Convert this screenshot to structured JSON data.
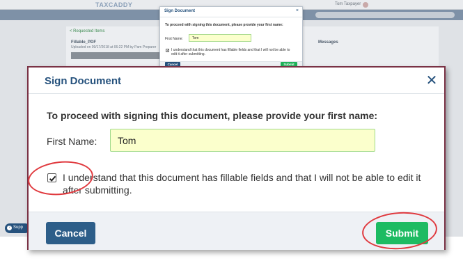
{
  "background": {
    "logo": "TAXCADDY",
    "user_name": "Tom Taxpayer",
    "back_link": "< Requested Items",
    "file_name": "Fillable_PDF",
    "uploaded_text": "Uploaded on 09/17/2018 at 06:22 PM by Pam Preparer",
    "messages_header": "Messages",
    "support_label": "Supp"
  },
  "mini_dialog": {
    "title": "Sign Document",
    "close_glyph": "×",
    "prompt": "To proceed with signing this document, please provide your first name:",
    "first_name_label": "First Name:",
    "first_name_value": "Tom",
    "checkbox_text": "I understand that this document has fillable fields and that I will not be able to edit it after submitting.",
    "cancel_label": "Cancel",
    "submit_label": "Submit"
  },
  "dialog": {
    "title": "Sign Document",
    "close_glyph": "✕",
    "prompt": "To proceed with signing this document, please provide your first name:",
    "first_name_label": "First Name:",
    "first_name_value": "Tom",
    "checkbox_checked": true,
    "checkbox_text": "I understand that this document has fillable fields and that I will not be able to edit it after submitting.",
    "cancel_label": "Cancel",
    "submit_label": "Submit"
  },
  "colors": {
    "accent_blue": "#26527d",
    "submit_green": "#1dbb62",
    "input_fill": "#fbffcc",
    "annotation_red": "#e0393e"
  }
}
